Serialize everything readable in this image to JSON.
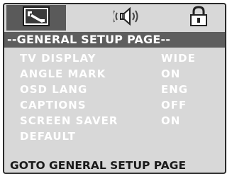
{
  "tabs": [
    {
      "icon": "general-setup-icon"
    },
    {
      "icon": "audio-setup-icon"
    },
    {
      "icon": "preference-lock-icon"
    }
  ],
  "header": {
    "title": "--GENERAL SETUP PAGE--"
  },
  "menu": {
    "items": [
      {
        "label": "TV DISPLAY",
        "value": "WIDE"
      },
      {
        "label": "ANGLE MARK",
        "value": "ON"
      },
      {
        "label": "OSD LANG",
        "value": "ENG"
      },
      {
        "label": "CAPTIONS",
        "value": "OFF"
      },
      {
        "label": "SCREEN SAVER",
        "value": "ON"
      },
      {
        "label": "DEFAULT",
        "value": ""
      }
    ]
  },
  "footer": {
    "status": "GOTO GENERAL SETUP PAGE"
  },
  "colors": {
    "screen_bg": "#d8d8d8",
    "highlight": "#5e5e5e",
    "text": "#ffffff",
    "footer_text": "#1a1a1a"
  }
}
